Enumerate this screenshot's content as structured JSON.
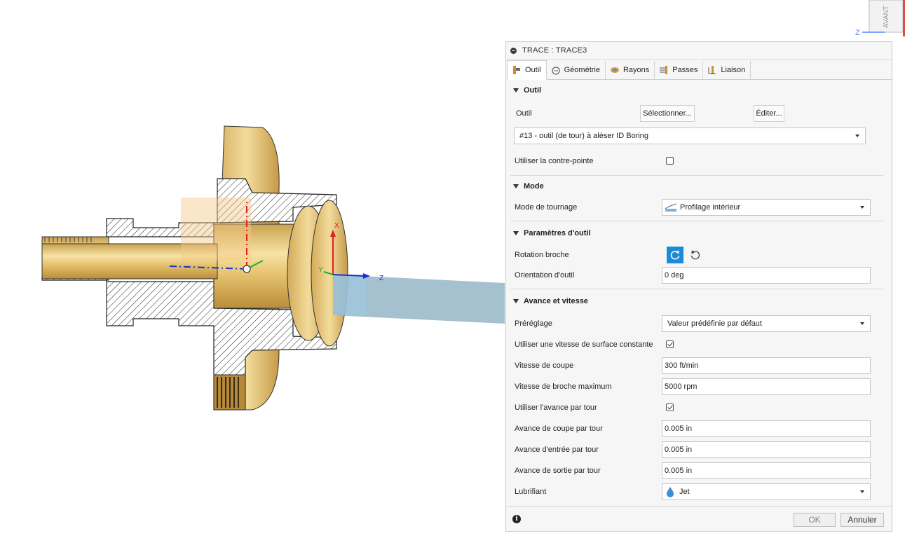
{
  "viewcube": {
    "face_label": "AVANT",
    "axis_label": "Z"
  },
  "viewport": {
    "axis_x": "X",
    "axis_y": "Y",
    "axis_z": "Z"
  },
  "panel": {
    "title": "TRACE : TRACE3",
    "tabs": [
      {
        "label": "Outil",
        "icon": "tool-tab-icon"
      },
      {
        "label": "Géométrie",
        "icon": "geometry-tab-icon"
      },
      {
        "label": "Rayons",
        "icon": "radii-tab-icon"
      },
      {
        "label": "Passes",
        "icon": "passes-tab-icon"
      },
      {
        "label": "Liaison",
        "icon": "linking-tab-icon"
      }
    ],
    "sections": {
      "outil": {
        "title": "Outil",
        "tool_label": "Outil",
        "select_button": "Sélectionner...",
        "edit_button": "Éditer...",
        "tool_value": "#13 - outil (de tour) à aléser ID Boring",
        "tailstock_label": "Utiliser la contre-pointe",
        "tailstock_checked": false
      },
      "mode": {
        "title": "Mode",
        "turning_mode_label": "Mode de tournage",
        "turning_mode_value": "Profilage intérieur"
      },
      "tool_params": {
        "title": "Paramètres d'outil",
        "spindle_label": "Rotation broche",
        "orientation_label": "Orientation d'outil",
        "orientation_value": "0 deg"
      },
      "feed_speed": {
        "title": "Avance et vitesse",
        "preset_label": "Préréglage",
        "preset_value": "Valeur prédéfinie par défaut",
        "css_label": "Utiliser une vitesse de surface constante",
        "css_checked": true,
        "cutting_speed_label": "Vitesse de coupe",
        "cutting_speed_value": "300 ft/min",
        "max_spindle_label": "Vitesse de broche maximum",
        "max_spindle_value": "5000 rpm",
        "feed_per_rev_label": "Utiliser l'avance par tour",
        "feed_per_rev_checked": true,
        "cut_feed_label": "Avance de coupe par tour",
        "cut_feed_value": "0.005 in",
        "lead_in_label": "Avance d'entrée par tour",
        "lead_in_value": "0.005 in",
        "lead_out_label": "Avance de sortie par tour",
        "lead_out_value": "0.005 in",
        "coolant_label": "Lubrifiant",
        "coolant_value": "Jet"
      }
    },
    "footer": {
      "ok": "OK",
      "cancel": "Annuler"
    }
  },
  "colors": {
    "accent": "#1d8ad8",
    "part_gold": "#e8c77a",
    "tool_blue": "#8fb0c3"
  }
}
